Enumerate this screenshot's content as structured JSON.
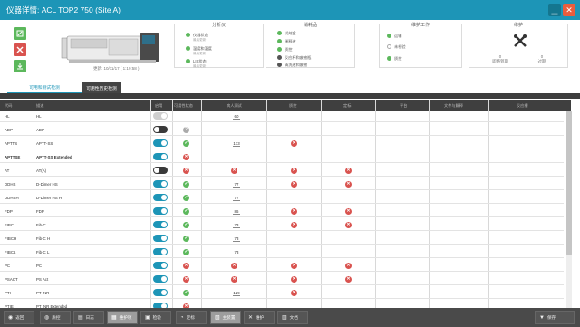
{
  "window": {
    "title": "仪器详情: ACL TOP2 750 (Site A)",
    "minimize_glyph": "▁",
    "close_glyph": "✕"
  },
  "instrument": {
    "caption": "更新: 10/11/17 ( 1:19:58 )"
  },
  "sidebar_actions": [
    {
      "icon": "edit-icon",
      "color": "#5cb85c"
    },
    {
      "icon": "tools-icon",
      "color": "#d9534f"
    },
    {
      "icon": "download-icon",
      "color": "#5cb85c"
    }
  ],
  "panels": {
    "analyzer": {
      "title": "分析仪",
      "items": [
        {
          "label": "仪器状态",
          "sub": "最后更新",
          "color": "#5cb85c"
        },
        {
          "label": "温度和湿度",
          "sub": "最后更新",
          "color": "#5cb85c"
        },
        {
          "label": "LIS状态",
          "sub": "最后更新",
          "color": "#5cb85c"
        }
      ]
    },
    "reagents": {
      "title": "消耗品",
      "items": [
        {
          "label": "试剂盒",
          "color": "#5cb85c"
        },
        {
          "label": "稀释液",
          "color": "#5cb85c"
        },
        {
          "label": "质控",
          "color": "#5cb85c"
        },
        {
          "label": "反应杯和废液瓶",
          "color": "#555"
        },
        {
          "label": "清洗液和废液",
          "color": "#555"
        }
      ]
    },
    "duty": {
      "title": "维护工作",
      "items": [
        {
          "label": "运输",
          "color": "#5cb85c"
        },
        {
          "label": "未检验",
          "color": "#fff"
        },
        {
          "label": "质控",
          "color": "#5cb85c"
        }
      ]
    },
    "maintenance": {
      "title": "维护",
      "stats": [
        {
          "value": "0",
          "label": "即将到期"
        },
        {
          "value": "0",
          "label": "过期"
        }
      ]
    }
  },
  "tabs": [
    {
      "label": "可用和测试检测"
    },
    {
      "label": "可用性历史检测"
    }
  ],
  "table": {
    "headers": [
      "代码",
      "描述",
      "启用",
      "可用性状态",
      "病人测试",
      "质控",
      "定标",
      "平台",
      "文件与解释",
      "反应槽"
    ],
    "rows": [
      {
        "code": "HL",
        "desc": "HL",
        "toggle": "dis",
        "avail": "",
        "patient": "60",
        "qc": "",
        "cal": ""
      },
      {
        "code": "ADP",
        "desc": "ADP",
        "toggle": "off",
        "avail": "qm",
        "patient": "",
        "qc": "",
        "cal": ""
      },
      {
        "code": "APTTS",
        "desc": "APTT-SS",
        "toggle": "on",
        "avail": "ok",
        "patient": "173",
        "qc": "err",
        "cal": ""
      },
      {
        "code": "APTTSE",
        "desc": "APTT-SS Extended",
        "toggle": "on",
        "avail": "err",
        "patient": "",
        "qc": "",
        "cal": "",
        "bold": true
      },
      {
        "code": "AT",
        "desc": "AT(A)",
        "toggle": "off",
        "avail": "err",
        "patient": "err",
        "qc": "err",
        "cal": "err"
      },
      {
        "code": "DDHS",
        "desc": "D-Dimer HS",
        "toggle": "on",
        "avail": "ok",
        "patient": "77",
        "qc": "err",
        "cal": "err"
      },
      {
        "code": "DDHSH",
        "desc": "D-Dimer HS H",
        "toggle": "on",
        "avail": "ok",
        "patient": "77",
        "qc": "",
        "cal": ""
      },
      {
        "code": "FDP",
        "desc": "FDP",
        "toggle": "on",
        "avail": "ok",
        "patient": "86",
        "qc": "err",
        "cal": "err"
      },
      {
        "code": "FIBC",
        "desc": "Fib-C",
        "toggle": "on",
        "avail": "ok",
        "patient": "73",
        "qc": "err",
        "cal": "err"
      },
      {
        "code": "FIBCH",
        "desc": "Fib-C H",
        "toggle": "on",
        "avail": "ok",
        "patient": "73",
        "qc": "",
        "cal": ""
      },
      {
        "code": "FIBCL",
        "desc": "Fib-C L",
        "toggle": "on",
        "avail": "ok",
        "patient": "73",
        "qc": "",
        "cal": ""
      },
      {
        "code": "PC",
        "desc": "PC",
        "toggle": "on",
        "avail": "err",
        "patient": "err",
        "qc": "err",
        "cal": "err"
      },
      {
        "code": "PSACT",
        "desc": "PS Act",
        "toggle": "on",
        "avail": "err",
        "patient": "err",
        "qc": "err",
        "cal": "err"
      },
      {
        "code": "PTI",
        "desc": "PT INR",
        "toggle": "on",
        "avail": "ok",
        "patient": "129",
        "qc": "err",
        "cal": ""
      },
      {
        "code": "PTIE",
        "desc": "PT INR Extended",
        "toggle": "on",
        "avail": "err",
        "patient": "",
        "qc": "",
        "cal": ""
      }
    ]
  },
  "bottom_bar": [
    {
      "label": "返回",
      "icon": "◉",
      "sel": false
    },
    {
      "label": "质控",
      "icon": "◍",
      "sel": false
    },
    {
      "label": "日志",
      "icon": "▤",
      "sel": false
    },
    {
      "label": "维护项",
      "icon": "▦",
      "sel": true
    },
    {
      "label": "检验",
      "icon": "▣",
      "sel": false
    },
    {
      "label": "定标",
      "icon": "◔",
      "sel": false
    },
    {
      "label": "主装置",
      "icon": "▧",
      "sel": true
    },
    {
      "label": "维护",
      "icon": "✕",
      "sel": false
    },
    {
      "label": "文档",
      "icon": "▥",
      "sel": false
    },
    {
      "label": "保存",
      "icon": "▼",
      "sel": false
    }
  ]
}
